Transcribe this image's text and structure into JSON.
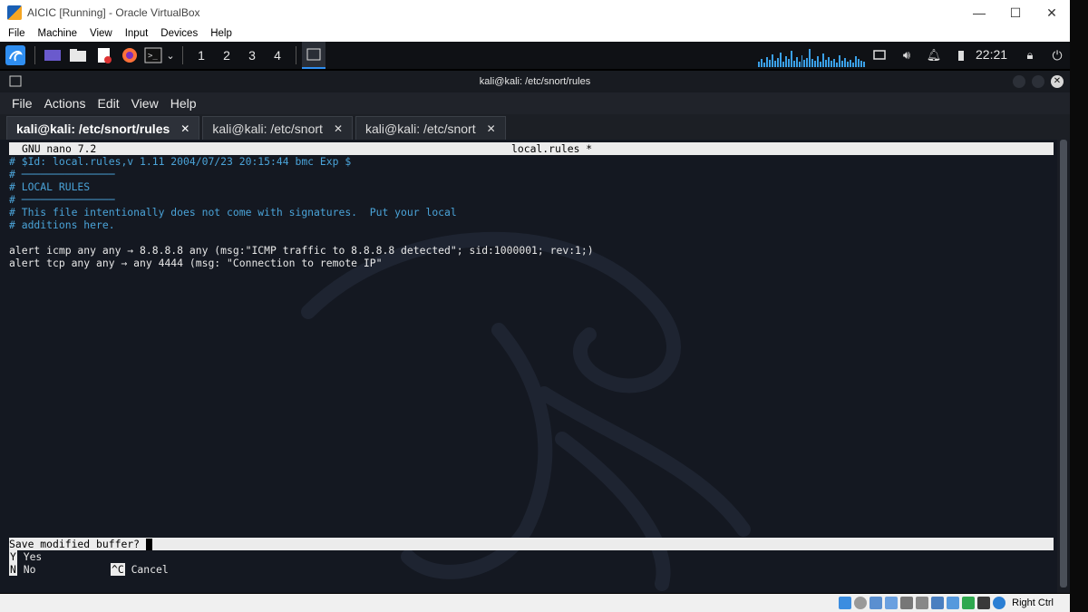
{
  "vbox": {
    "title": "AICIC [Running] - Oracle VirtualBox",
    "menu": [
      "File",
      "Machine",
      "View",
      "Input",
      "Devices",
      "Help"
    ],
    "status_host_key": "Right Ctrl"
  },
  "panel": {
    "workspaces": [
      "1",
      "2",
      "3",
      "4"
    ],
    "clock": "22:21"
  },
  "terminal": {
    "title": "kali@kali: /etc/snort/rules",
    "menu": [
      "File",
      "Actions",
      "Edit",
      "View",
      "Help"
    ],
    "tabs": [
      {
        "label": "kali@kali: /etc/snort/rules"
      },
      {
        "label": "kali@kali: /etc/snort"
      },
      {
        "label": "kali@kali: /etc/snort"
      }
    ]
  },
  "nano": {
    "version": "GNU nano 7.2",
    "filename": "local.rules *",
    "lines": [
      {
        "text": "# $Id: local.rules,v 1.11 2004/07/23 20:15:44 bmc Exp $",
        "kind": "comment"
      },
      {
        "text": "# ───────────────",
        "kind": "comment"
      },
      {
        "text": "# LOCAL RULES",
        "kind": "comment"
      },
      {
        "text": "# ───────────────",
        "kind": "comment"
      },
      {
        "text": "# This file intentionally does not come with signatures.  Put your local",
        "kind": "comment"
      },
      {
        "text": "# additions here.",
        "kind": "comment"
      },
      {
        "text": "",
        "kind": "text"
      },
      {
        "text": "alert icmp any any → 8.8.8.8 any (msg:\"ICMP traffic to 8.8.8.8 detected\"; sid:1000001; rev:1;)",
        "kind": "text"
      },
      {
        "text": "alert tcp any any → any 4444 (msg: \"Connection to remote IP\"",
        "kind": "text"
      }
    ],
    "prompt": "Save modified buffer? ",
    "options": [
      {
        "key": "Y",
        "label": "Yes"
      },
      {
        "key": "N",
        "label": "No"
      },
      {
        "key": "^C",
        "label": "Cancel"
      }
    ]
  },
  "colors": {
    "terminal_bg": "#141821",
    "comment": "#4aa3d8",
    "accent": "#2f8ef0"
  }
}
